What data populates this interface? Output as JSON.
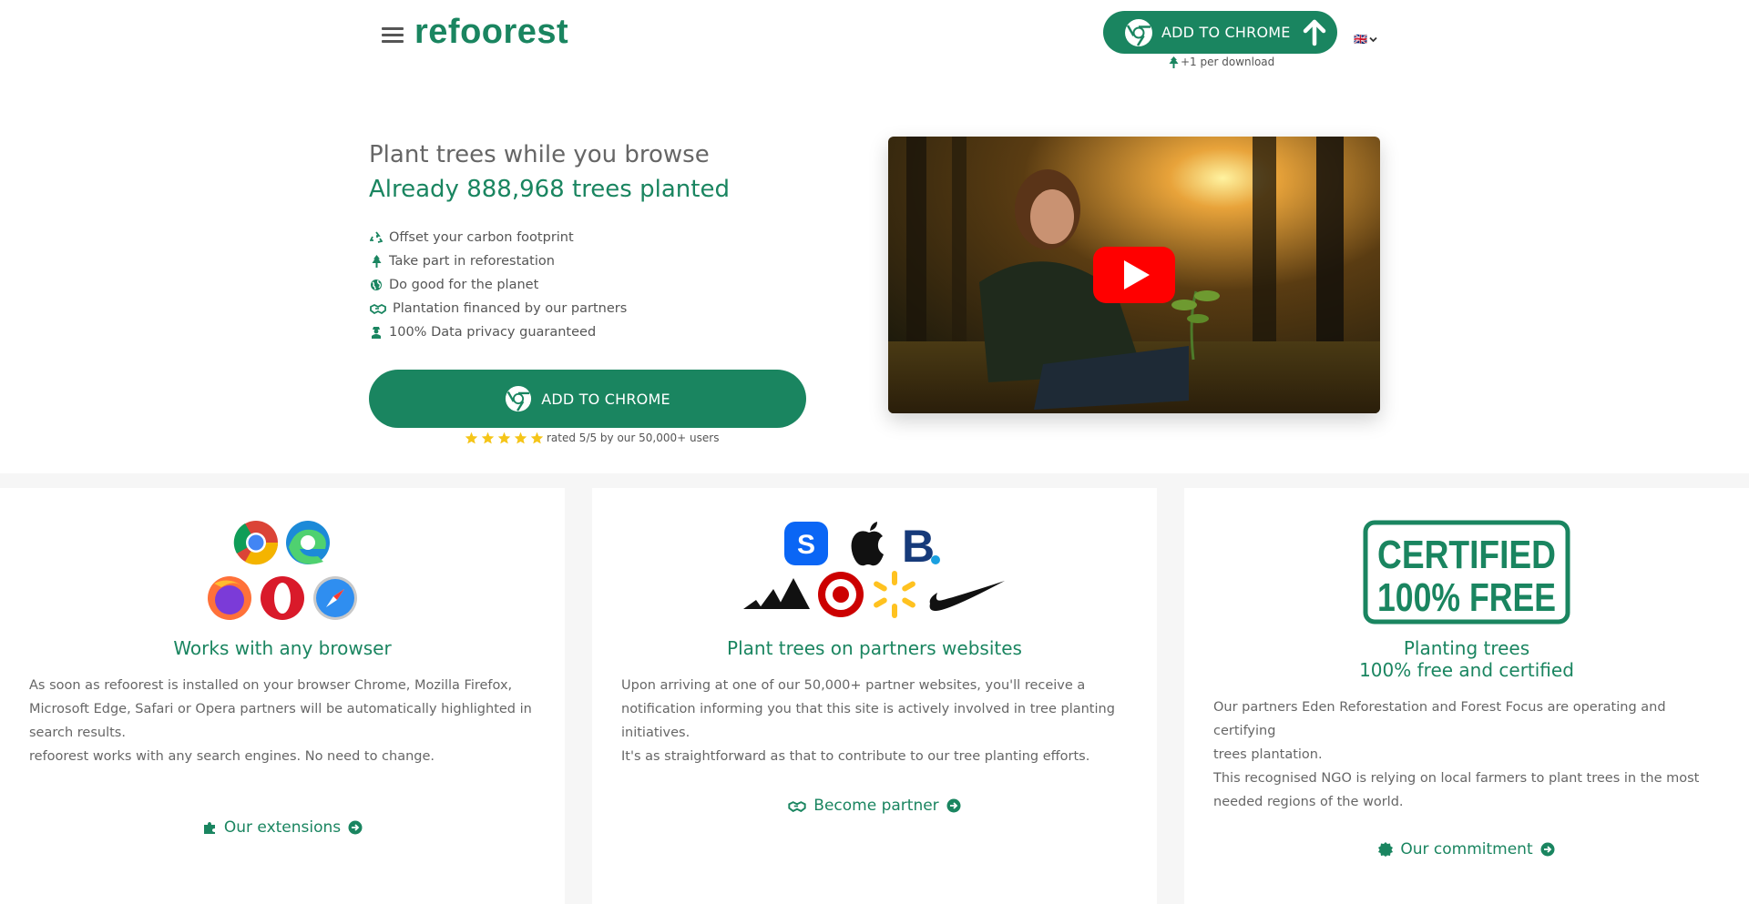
{
  "header": {
    "logo": "refoorest",
    "cta_label": "ADD TO CHROME",
    "per_download": "+1 per download",
    "language": "🇬🇧"
  },
  "hero": {
    "title": "Plant trees while you browse",
    "subtitle": "Already 888,968 trees planted",
    "features": [
      {
        "icon": "recycle-icon",
        "label": "Offset your carbon footprint"
      },
      {
        "icon": "tree-icon",
        "label": "Take part in reforestation"
      },
      {
        "icon": "globe-icon",
        "label": "Do good for the planet"
      },
      {
        "icon": "handshake-icon",
        "label": "Plantation financed by our partners"
      },
      {
        "icon": "user-secret-icon",
        "label": "100% Data privacy guaranteed"
      }
    ],
    "cta_label": "ADD TO CHROME",
    "rating_text": "rated 5/5 by our 50,000+ users",
    "rating_stars": 5
  },
  "cards": [
    {
      "title": "Works with any browser",
      "paragraphs": [
        "As soon as refoorest is installed on your browser Chrome, Mozilla Firefox,",
        "Microsoft Edge, Safari or Opera partners will be automatically highlighted in",
        "search results.",
        "refoorest works with any search engines. No need to change."
      ],
      "link": "Our extensions"
    },
    {
      "title": "Plant trees on partners websites",
      "paragraphs": [
        "Upon arriving at one of our 50,000+ partner websites, you'll receive a",
        "notification informing you that this site is actively involved in tree planting",
        "initiatives.",
        "It's as straightforward as that to contribute to our tree planting efforts."
      ],
      "link": "Become partner"
    },
    {
      "title_line1": "Planting trees",
      "title_line2": "100% free and certified",
      "badge_line1": "CERTIFIED",
      "badge_line2": "100% FREE",
      "paragraphs": [
        "Our partners Eden Reforestation and Forest Focus are operating and certifying",
        "trees plantation.",
        "This recognised NGO is relying on local farmers to plant trees in the most",
        "needed regions of the world."
      ],
      "link": "Our commitment"
    }
  ],
  "colors": {
    "brand_green": "#1a8560",
    "star_yellow": "#f5c518",
    "youtube_red": "#ff0000"
  }
}
